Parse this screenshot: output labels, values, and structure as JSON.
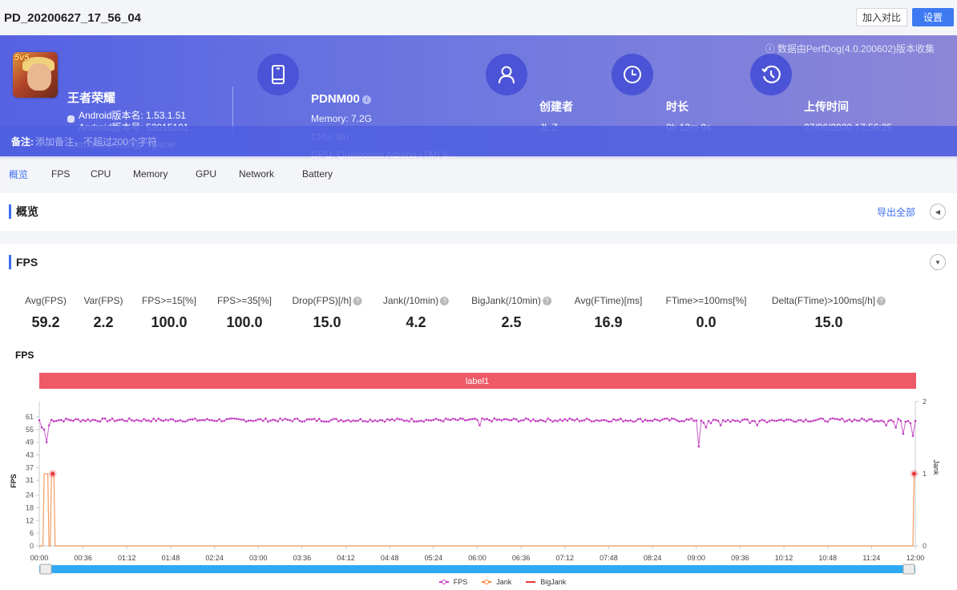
{
  "header": {
    "title": "PD_20200627_17_56_04",
    "compare_label": "加入对比",
    "settings_label": "设置"
  },
  "banner": {
    "collect_note": "ⓘ 数据由PerfDog(4.0.200602)版本收集",
    "app": {
      "icon_tag": "5v5",
      "name": "王者荣耀",
      "version_name": "Android版本名: 1.53.1.51",
      "version_code": "Android版本号: 53015101",
      "package": "com.tencent.tmgp.sgame"
    },
    "device": {
      "name": "PDNM00",
      "memory": "Memory: 7.2G",
      "cpu": "CPU: lito",
      "gpu": "GPU: Qualcomm Adreno (TM) 6..."
    },
    "creator": {
      "label": "创建者",
      "value": "JL Z"
    },
    "duration": {
      "label": "时长",
      "value": "0h 12m 0s"
    },
    "upload": {
      "label": "上传时间",
      "value": "27/06/2020 17:56:25"
    },
    "remark_label": "备注:",
    "remark_placeholder": "添加备注，不超过200个字符"
  },
  "tabs": [
    "概览",
    "FPS",
    "CPU",
    "Memory",
    "GPU",
    "Network",
    "Battery"
  ],
  "active_tab": 0,
  "overview": {
    "title": "概览",
    "export_label": "导出全部"
  },
  "fps_panel": {
    "title": "FPS",
    "metrics": [
      {
        "label": "Avg(FPS)",
        "value": "59.2",
        "help": false
      },
      {
        "label": "Var(FPS)",
        "value": "2.2",
        "help": false
      },
      {
        "label": "FPS>=15[%]",
        "value": "100.0",
        "help": false
      },
      {
        "label": "FPS>=35[%]",
        "value": "100.0",
        "help": false
      },
      {
        "label": "Drop(FPS)[/h]",
        "value": "15.0",
        "help": true
      },
      {
        "label": "Jank(/10min)",
        "value": "4.2",
        "help": true
      },
      {
        "label": "BigJank(/10min)",
        "value": "2.5",
        "help": true
      },
      {
        "label": "Avg(FTime)[ms]",
        "value": "16.9",
        "help": false
      },
      {
        "label": "FTime>=100ms[%]",
        "value": "0.0",
        "help": false
      },
      {
        "label": "Delta(FTime)>100ms[/h]",
        "value": "15.0",
        "help": true
      }
    ]
  },
  "chart_data": {
    "type": "line",
    "title": "FPS",
    "label_band": "label1",
    "label_band_color": "#ee5a68",
    "ylabel": "FPS",
    "y2label": "Jank",
    "ylim": [
      0,
      61
    ],
    "y_ticks": [
      0,
      6,
      12,
      18,
      24,
      31,
      37,
      43,
      49,
      55,
      61
    ],
    "y2lim": [
      0,
      2
    ],
    "y2_ticks": [
      0,
      1,
      2
    ],
    "x_ticks": [
      "00:00",
      "00:36",
      "01:12",
      "01:48",
      "02:24",
      "03:00",
      "03:36",
      "04:12",
      "04:48",
      "05:24",
      "06:00",
      "06:36",
      "07:12",
      "07:48",
      "08:24",
      "09:00",
      "09:36",
      "10:12",
      "10:48",
      "11:24",
      "12:00"
    ],
    "x_range_seconds": [
      0,
      720
    ],
    "series": [
      {
        "name": "FPS",
        "color": "#c33dbf",
        "axis": "left",
        "baseline": 59.5,
        "dips": [
          [
            3,
            56
          ],
          [
            5,
            55
          ],
          [
            7,
            49
          ],
          [
            9,
            57
          ],
          [
            363,
            57
          ],
          [
            543,
            47
          ],
          [
            548,
            56
          ],
          [
            553,
            58
          ],
          [
            560,
            57
          ],
          [
            590,
            57
          ],
          [
            697,
            57
          ],
          [
            704,
            56
          ],
          [
            710,
            53
          ],
          [
            716,
            58
          ],
          [
            718,
            52
          ]
        ]
      },
      {
        "name": "Jank",
        "color": "#f5843a",
        "axis": "right",
        "points": [
          [
            0,
            0
          ],
          [
            3,
            0
          ],
          [
            4,
            1
          ],
          [
            7,
            1
          ],
          [
            8,
            0
          ],
          [
            9,
            0
          ],
          [
            10,
            1
          ],
          [
            12,
            1
          ],
          [
            13,
            0
          ],
          [
            718,
            0
          ],
          [
            719,
            1
          ],
          [
            720,
            1
          ]
        ]
      },
      {
        "name": "BigJank",
        "color": "#e8363b",
        "axis": "right",
        "markers": [
          [
            11,
            1
          ],
          [
            719,
            1
          ]
        ]
      }
    ],
    "legend": [
      "FPS",
      "Jank",
      "BigJank"
    ],
    "legend_position": "bottom-center"
  }
}
